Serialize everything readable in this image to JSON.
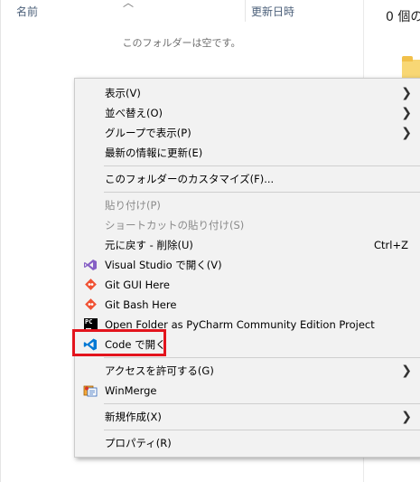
{
  "explorer": {
    "column_name": "名前",
    "column_date": "更新日時",
    "empty_message": "このフォルダーは空です。",
    "item_count": "0 個の"
  },
  "context_menu": {
    "view": "表示(V)",
    "sort_by": "並べ替え(O)",
    "group_by": "グループで表示(P)",
    "refresh": "最新の情報に更新(E)",
    "customize_folder": "このフォルダーのカスタマイズ(F)...",
    "paste": "貼り付け(P)",
    "paste_shortcut": "ショートカットの貼り付け(S)",
    "undo_delete": "元に戻す - 削除(U)",
    "undo_shortcut": "Ctrl+Z",
    "open_visual_studio": "Visual Studio で開く(V)",
    "git_gui": "Git GUI Here",
    "git_bash": "Git Bash Here",
    "open_pycharm": "Open Folder as PyCharm Community Edition Project",
    "open_code": "Code で開く",
    "give_access": "アクセスを許可する(G)",
    "winmerge": "WinMerge",
    "new": "新規作成(X)",
    "properties": "プロパティ(R)"
  },
  "icons": {
    "visual_studio": "visual-studio-icon",
    "git_gui": "git-icon",
    "git_bash": "git-icon",
    "pycharm": "pycharm-icon",
    "vscode": "vscode-icon",
    "winmerge": "winmerge-icon"
  },
  "colors": {
    "highlight_border": "#e3141d",
    "menu_background": "#f2f2f2",
    "vscode_blue": "#0078d4",
    "visual_studio_purple": "#865fc5",
    "git_orange": "#f05133"
  }
}
